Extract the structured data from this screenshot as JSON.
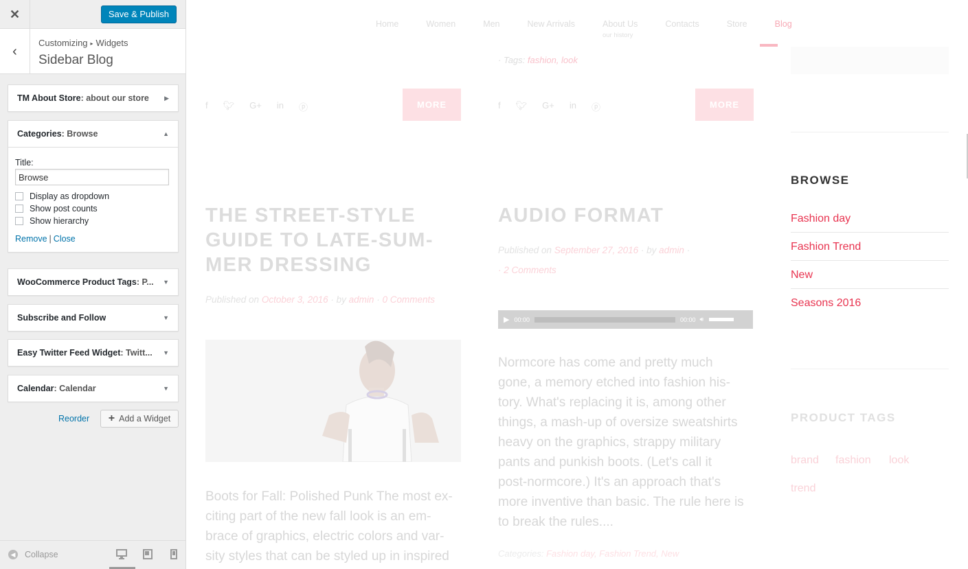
{
  "customizer": {
    "close_icon": "close-icon",
    "publish_label": "Save & Publish",
    "breadcrumb": {
      "part1": "Customizing",
      "separator": "▸",
      "part2": "Widgets"
    },
    "section_title": "Sidebar Blog",
    "widgets": [
      {
        "name": "TM About Store",
        "subtitle": ": about our store",
        "state": "collapsed-right"
      },
      {
        "name": "Categories",
        "subtitle": ": Browse",
        "state": "expanded"
      },
      {
        "name": "WooCommerce Product Tags",
        "subtitle": ": P...",
        "state": "collapsed"
      },
      {
        "name": "Subscribe and Follow",
        "subtitle": "",
        "state": "collapsed"
      },
      {
        "name": "Easy Twitter Feed Widget",
        "subtitle": ": Twitt...",
        "state": "collapsed"
      },
      {
        "name": "Calendar",
        "subtitle": ": Calendar",
        "state": "collapsed"
      }
    ],
    "categories_form": {
      "title_label": "Title:",
      "title_value": "Browse",
      "options": [
        "Display as dropdown",
        "Show post counts",
        "Show hierarchy"
      ],
      "remove_label": "Remove",
      "divider": "|",
      "close_label": "Close"
    },
    "reorder_label": "Reorder",
    "add_widget_label": "Add a Widget",
    "collapse_label": "Collapse",
    "accent_color": "#0085ba"
  },
  "preview": {
    "nav": [
      {
        "label": "Home"
      },
      {
        "label": "Women"
      },
      {
        "label": "Men"
      },
      {
        "label": "New Arrivals"
      },
      {
        "label": "About Us",
        "sub": "our history"
      },
      {
        "label": "Contacts"
      },
      {
        "label": "Store"
      },
      {
        "label": "Blog",
        "active": true
      }
    ],
    "tags_line": {
      "prefix": "· Tags: ",
      "tag1": "fashion",
      "comma": ", ",
      "tag2": "look"
    },
    "more_label": "MORE",
    "post1": {
      "title_lines": [
        "THE STREET-STYLE",
        "GUIDE TO LATE-SUM-",
        "MER DRESSING"
      ],
      "meta_published": "Published on ",
      "meta_date": "October 3, 2016",
      "meta_by": " · by ",
      "meta_author": "admin",
      "meta_dot": " · ",
      "meta_comments": "0 Comments",
      "excerpt_lines": [
        "Boots for Fall: Polished Punk The most ex-",
        "citing part of the new fall look is an em-",
        "brace of graphics, electric colors and var-",
        "sity styles that can be styled up in inspired"
      ]
    },
    "post2": {
      "title": "AUDIO FORMAT",
      "meta_published": "Published on ",
      "meta_date": "September 27, 2016",
      "meta_by": " · by ",
      "meta_author": "admin",
      "meta_dot2": " · ",
      "meta_comments": "·   2 Comments",
      "audio": {
        "time_start": "00:00",
        "time_end": "00:00"
      },
      "excerpt_lines": [
        "Normcore has come and pretty much",
        "gone, a memory etched into fashion his-",
        "tory. What's replacing it is, among other",
        "things, a mash-up of oversize sweatshirts",
        "heavy on the graphics, strappy military",
        "pants and punkish boots. (Let's call it",
        "post-normcore.) It's an approach that's",
        "more inventive than basic. The rule here is",
        "to break the rules...."
      ],
      "categories_line": {
        "prefix": "Categories: ",
        "cats": "Fashion day, Fashion Trend, New"
      }
    },
    "sidebar": {
      "browse_heading": "BROWSE",
      "browse_items": [
        "Fashion day",
        "Fashion Trend",
        "New",
        "Seasons 2016"
      ],
      "tags_heading": "PRODUCT TAGS",
      "tags": [
        "brand",
        "fashion",
        "look",
        "trend"
      ]
    },
    "accent_color": "#e8334f"
  }
}
